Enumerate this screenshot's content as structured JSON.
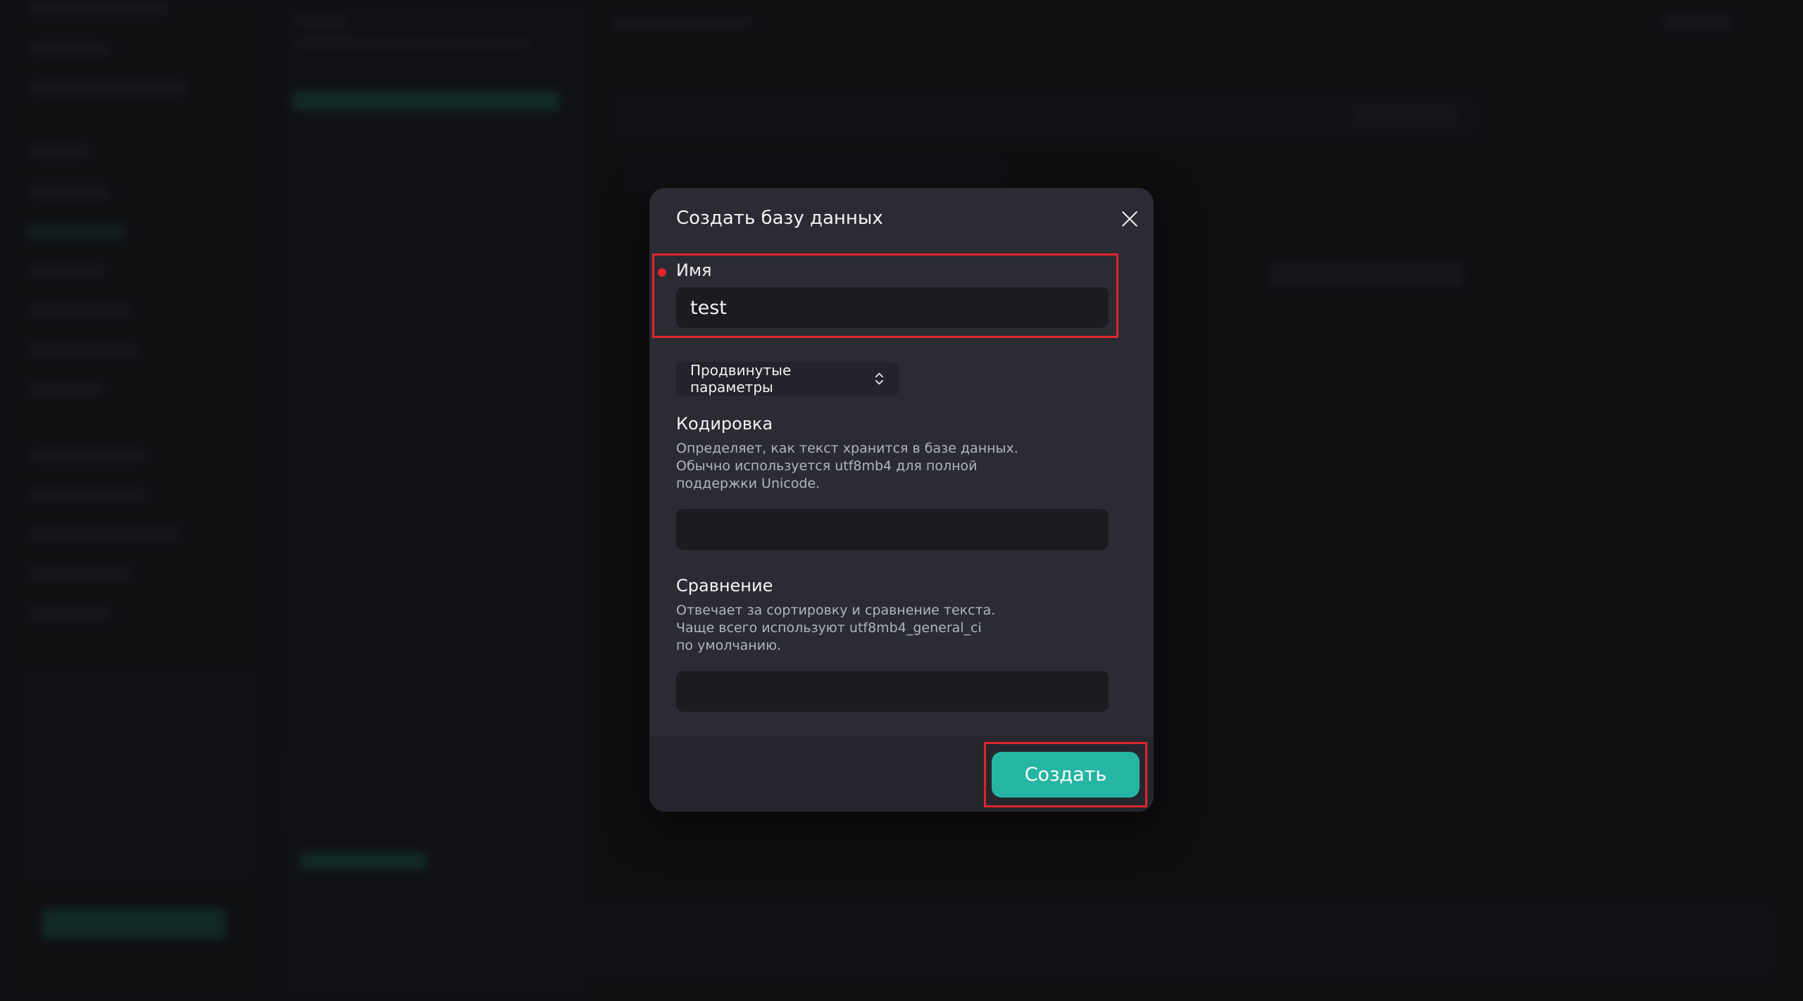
{
  "modal": {
    "title": "Создать базу данных",
    "name_field": {
      "label": "Имя",
      "value": "test",
      "required": true
    },
    "advanced_toggle": {
      "label": "Продвинутые параметры"
    },
    "encoding": {
      "title": "Кодировка",
      "description_lines": [
        "Определяет, как текст хранится в базе данных.",
        "Обычно используется utf8mb4 для полной",
        "поддержки Unicode."
      ],
      "value": ""
    },
    "collation": {
      "title": "Сравнение",
      "description_lines": [
        "Отвечает за сортировку и сравнение текста.",
        "Чаще всего используют utf8mb4_general_ci",
        "по умолчанию."
      ],
      "value": ""
    },
    "submit_label": "Создать"
  },
  "icons": {
    "close": "close-icon",
    "advanced": "chevron-up-down-icon"
  },
  "colors": {
    "accent": "#27b5a3",
    "highlight": "#e0262b",
    "modal_bg": "#2a2b33",
    "input_bg": "#1b1c21"
  }
}
